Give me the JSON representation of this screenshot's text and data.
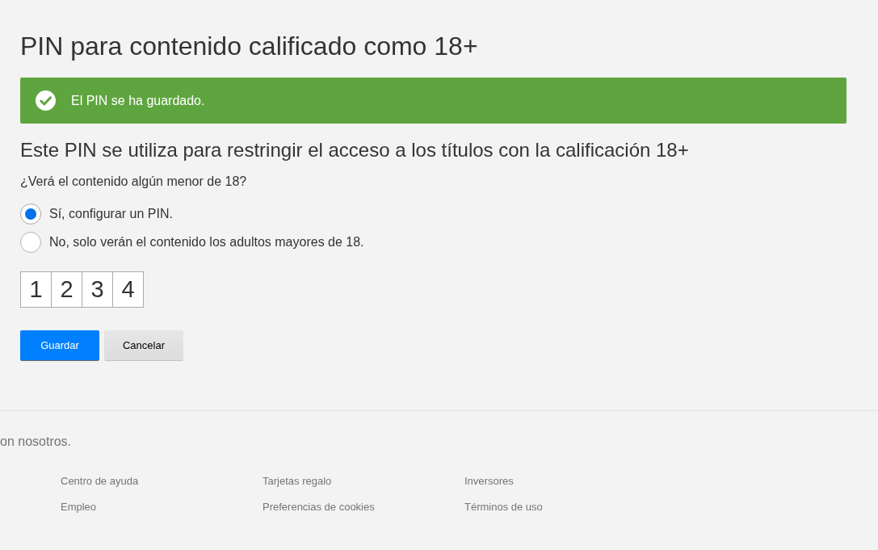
{
  "page": {
    "title": "PIN para contenido calificado como 18+"
  },
  "alert": {
    "kind": "success",
    "message": "El PIN se ha guardado."
  },
  "section": {
    "heading": "Este PIN se utiliza para restringir el acceso a los títulos con la calificación 18+",
    "question": "¿Verá el contenido algún menor de 18?",
    "options": [
      {
        "label": "Sí, configurar un PIN.",
        "selected": true
      },
      {
        "label": "No, solo verán el contenido los adultos mayores de 18.",
        "selected": false
      }
    ]
  },
  "pin": {
    "digits": [
      "1",
      "2",
      "3",
      "4"
    ]
  },
  "buttons": [
    {
      "label": "Guardar",
      "kind": "primary"
    },
    {
      "label": "Cancelar",
      "kind": "secondary"
    }
  ],
  "footer": {
    "contact_text": "on nosotros.",
    "links": [
      "Centro de ayuda",
      "Tarjetas regalo",
      "Inversores",
      "Empleo",
      "Preferencias de cookies",
      "Términos de uso"
    ]
  }
}
